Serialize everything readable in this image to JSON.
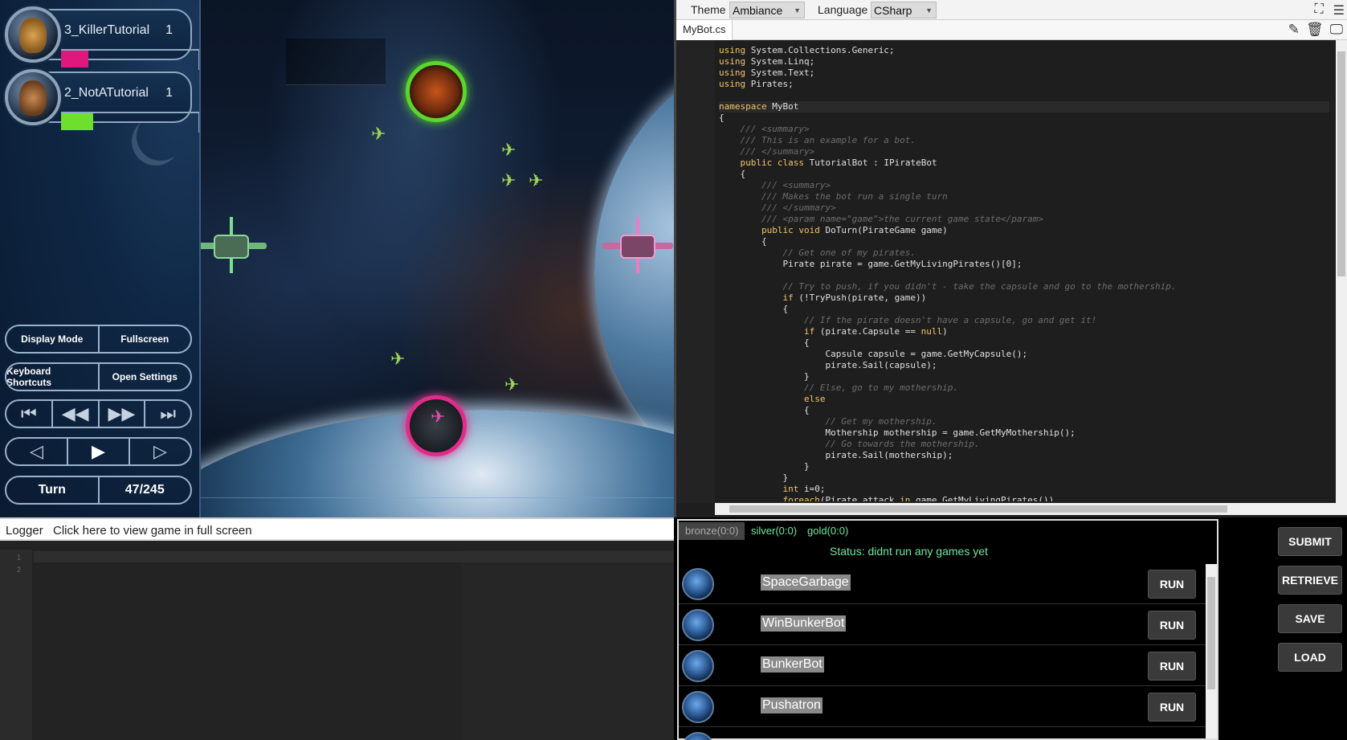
{
  "players": [
    {
      "name": "3_KillerTutorial",
      "score": "1",
      "color": "#e0177c"
    },
    {
      "name": "2_NotATutorial",
      "score": "1",
      "color": "#6ee02b"
    }
  ],
  "controls": {
    "display_mode": "Display Mode",
    "fullscreen": "Fullscreen",
    "keyboard_shortcuts": "Keyboard Shortcuts",
    "open_settings": "Open Settings",
    "turn_label": "Turn",
    "turn_value": "47/245"
  },
  "editor": {
    "theme_label": "Theme",
    "theme_value": "Ambiance",
    "language_label": "Language",
    "language_value": "CSharp",
    "file_tab": "MyBot.cs"
  },
  "code_lines": [
    "using System.Collections.Generic;",
    "using System.Linq;",
    "using System.Text;",
    "using Pirates;",
    "",
    "namespace MyBot",
    "{",
    "    /// <summary>",
    "    /// This is an example for a bot.",
    "    /// </summary>",
    "    public class TutorialBot : IPirateBot",
    "    {",
    "        /// <summary>",
    "        /// Makes the bot run a single turn",
    "        /// </summary>",
    "        /// <param name=\"game\">the current game state</param>",
    "        public void DoTurn(PirateGame game)",
    "        {",
    "            // Get one of my pirates.",
    "            Pirate pirate = game.GetMyLivingPirates()[0];",
    "",
    "            // Try to push, if you didn't - take the capsule and go to the mothership.",
    "            if (!TryPush(pirate, game))",
    "            {",
    "                // If the pirate doesn't have a capsule, go and get it!",
    "                if (pirate.Capsule == null)",
    "                {",
    "                    Capsule capsule = game.GetMyCapsule();",
    "                    pirate.Sail(capsule);",
    "                }",
    "                // Else, go to my mothership.",
    "                else",
    "                {",
    "                    // Get my mothership.",
    "                    Mothership mothership = game.GetMyMothership();",
    "                    // Go towards the mothership.",
    "                    pirate.Sail(mothership);",
    "                }",
    "            }",
    "            int i=0;",
    "            foreach(Pirate attack in game.GetMyLivingPirates())"
  ],
  "logger": {
    "label": "Logger",
    "fullscreen_link": "Click here to view game in full screen",
    "line_numbers": [
      "1",
      "2"
    ]
  },
  "leagues": {
    "bronze": "bronze(0:0)",
    "silver": "silver(0:0)",
    "gold": "gold(0:0)"
  },
  "status": "Status: didnt run any games yet",
  "bots": [
    {
      "name": "SpaceGarbage",
      "run": "RUN"
    },
    {
      "name": "WinBunkerBot",
      "run": "RUN"
    },
    {
      "name": "BunkerBot",
      "run": "RUN"
    },
    {
      "name": "Pushatron",
      "run": "RUN"
    }
  ],
  "actions": {
    "submit": "SUBMIT",
    "retrieve": "RETRIEVE",
    "save": "SAVE",
    "load": "LOAD"
  },
  "colors": {
    "status_green": "#6fe8a0",
    "player1": "#e0177c",
    "player2": "#6ee02b",
    "code_keyword": "#f3c56b"
  }
}
